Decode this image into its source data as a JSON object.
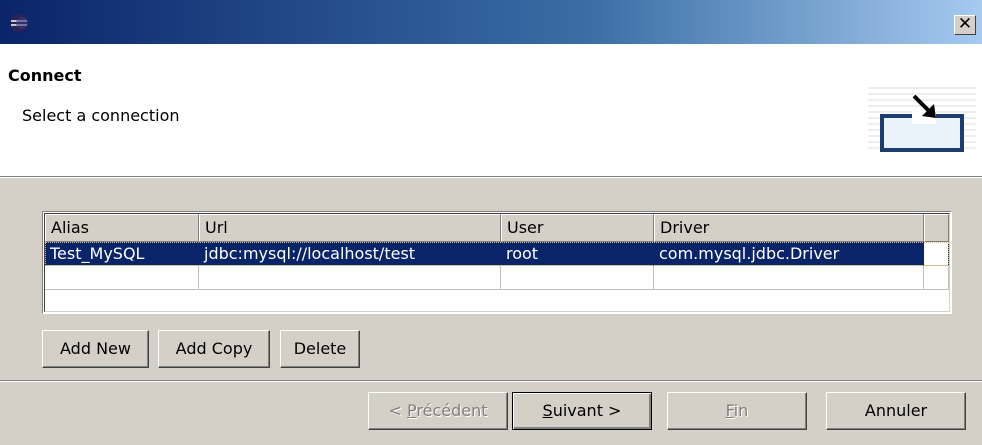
{
  "titlebar": {
    "close_glyph": "✕",
    "icon": "eclipse-icon"
  },
  "header": {
    "title": "Connect",
    "description": "Select a connection",
    "image": "connect-wizard-icon"
  },
  "table": {
    "columns": [
      "Alias",
      "Url",
      "User",
      "Driver",
      ""
    ],
    "rows": [
      [
        "Test_MySQL",
        "jdbc:mysql://localhost/test",
        "root",
        "com.mysql.jdbc.Driver",
        ""
      ],
      [
        "",
        "",
        "",
        "",
        ""
      ]
    ],
    "selected_row": 0
  },
  "buttons": {
    "add_new": "Add New",
    "add_copy": "Add Copy",
    "delete": "Delete"
  },
  "footer": {
    "back_mnemonic_prefix": "< ",
    "back_mnemonic": "P",
    "back_rest": "récédent",
    "next_mnemonic": "S",
    "next_rest": "uivant >",
    "finish_mnemonic": "F",
    "finish_rest": "in",
    "cancel": "Annuler"
  },
  "colors": {
    "selection": "#0a246a",
    "dialog_bg": "#d4d0c8"
  }
}
